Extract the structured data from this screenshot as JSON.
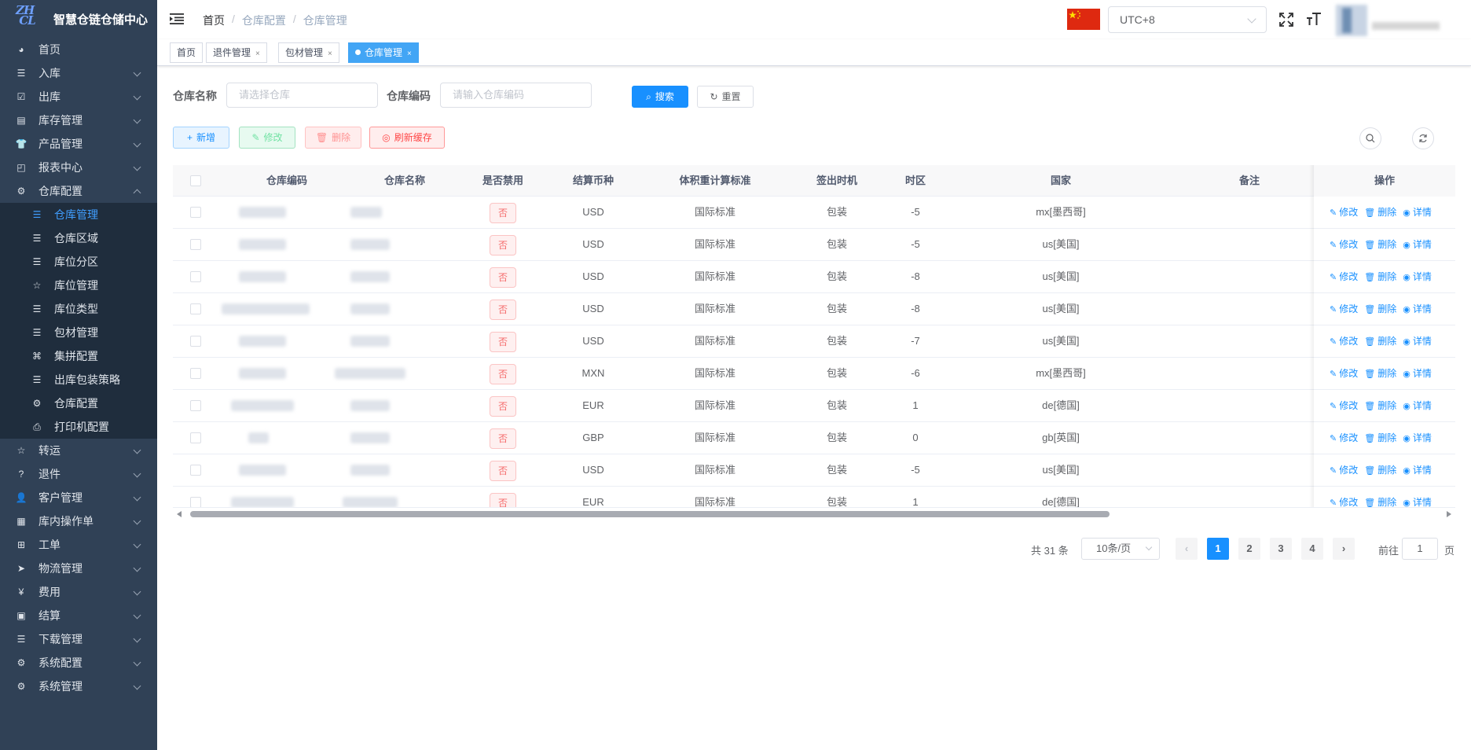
{
  "app": {
    "title": "智慧仓链仓储中心",
    "logo_text": "ZHCL"
  },
  "sidebar": {
    "items": [
      {
        "label": "首页",
        "icon": "dashboard-icon"
      },
      {
        "label": "入库",
        "icon": "list-icon"
      },
      {
        "label": "出库",
        "icon": "checkbox-icon"
      },
      {
        "label": "库存管理",
        "icon": "inventory-icon"
      },
      {
        "label": "产品管理",
        "icon": "shirt-icon"
      },
      {
        "label": "报表中心",
        "icon": "chart-icon"
      },
      {
        "label": "仓库配置",
        "icon": "gear-icon"
      },
      {
        "label": "转运",
        "icon": "star-icon"
      },
      {
        "label": "退件",
        "icon": "question-icon"
      },
      {
        "label": "客户管理",
        "icon": "user-icon"
      },
      {
        "label": "库内操作单",
        "icon": "doc-icon"
      },
      {
        "label": "工单",
        "icon": "grid-icon"
      },
      {
        "label": "物流管理",
        "icon": "send-icon"
      },
      {
        "label": "费用",
        "icon": "yen-icon"
      },
      {
        "label": "结算",
        "icon": "bill-icon"
      },
      {
        "label": "下载管理",
        "icon": "list-icon"
      },
      {
        "label": "系统配置",
        "icon": "gear-icon"
      },
      {
        "label": "系统管理",
        "icon": "gear-icon"
      }
    ],
    "submenu": [
      {
        "label": "仓库管理",
        "icon": "list-icon"
      },
      {
        "label": "仓库区域",
        "icon": "list-icon"
      },
      {
        "label": "库位分区",
        "icon": "list-icon"
      },
      {
        "label": "库位管理",
        "icon": "star-icon"
      },
      {
        "label": "库位类型",
        "icon": "list-icon"
      },
      {
        "label": "包材管理",
        "icon": "list-icon"
      },
      {
        "label": "集拼配置",
        "icon": "puzzle-icon"
      },
      {
        "label": "出库包装策略",
        "icon": "list-icon"
      },
      {
        "label": "仓库配置",
        "icon": "gear-icon"
      },
      {
        "label": "打印机配置",
        "icon": "printer-icon"
      }
    ]
  },
  "header": {
    "breadcrumb": [
      "首页",
      "仓库配置",
      "仓库管理"
    ],
    "timezone": "UTC+8"
  },
  "tags": [
    {
      "label": "首页"
    },
    {
      "label": "退件管理",
      "close": "×"
    },
    {
      "label": "包材管理",
      "close": "×"
    },
    {
      "label": "仓库管理",
      "close": "×"
    }
  ],
  "search": {
    "name_label": "仓库名称",
    "name_placeholder": "请选择仓库",
    "code_label": "仓库编码",
    "code_placeholder": "请输入仓库编码",
    "search_btn": "搜索",
    "reset_btn": "重置"
  },
  "toolbar": {
    "add": "新增",
    "edit": "修改",
    "delete": "删除",
    "refresh_cache": "刷新缓存"
  },
  "table": {
    "columns": [
      "仓库编码",
      "仓库名称",
      "是否禁用",
      "结算币种",
      "体积重计算标准",
      "签出时机",
      "时区",
      "国家",
      "备注",
      "操作"
    ],
    "rows": [
      {
        "disabled": "否",
        "currency": "USD",
        "standard": "国际标准",
        "checkout": "包装",
        "tz": "-5",
        "country": "mx[墨西哥]"
      },
      {
        "disabled": "否",
        "currency": "USD",
        "standard": "国际标准",
        "checkout": "包装",
        "tz": "-5",
        "country": "us[美国]"
      },
      {
        "disabled": "否",
        "currency": "USD",
        "standard": "国际标准",
        "checkout": "包装",
        "tz": "-8",
        "country": "us[美国]"
      },
      {
        "disabled": "否",
        "currency": "USD",
        "standard": "国际标准",
        "checkout": "包装",
        "tz": "-8",
        "country": "us[美国]"
      },
      {
        "disabled": "否",
        "currency": "USD",
        "standard": "国际标准",
        "checkout": "包装",
        "tz": "-7",
        "country": "us[美国]"
      },
      {
        "disabled": "否",
        "currency": "MXN",
        "standard": "国际标准",
        "checkout": "包装",
        "tz": "-6",
        "country": "mx[墨西哥]"
      },
      {
        "disabled": "否",
        "currency": "EUR",
        "standard": "国际标准",
        "checkout": "包装",
        "tz": "1",
        "country": "de[德国]"
      },
      {
        "disabled": "否",
        "currency": "GBP",
        "standard": "国际标准",
        "checkout": "包装",
        "tz": "0",
        "country": "gb[英国]"
      },
      {
        "disabled": "否",
        "currency": "USD",
        "standard": "国际标准",
        "checkout": "包装",
        "tz": "-5",
        "country": "us[美国]"
      },
      {
        "disabled": "否",
        "currency": "EUR",
        "standard": "国际标准",
        "checkout": "包装",
        "tz": "1",
        "country": "de[德国]"
      }
    ],
    "ops": {
      "edit": "修改",
      "delete": "删除",
      "detail": "详情"
    }
  },
  "pagination": {
    "total": "共 31 条",
    "page_size": "10条/页",
    "pages": [
      "1",
      "2",
      "3",
      "4"
    ],
    "goto_label": "前往",
    "goto_value": "1",
    "page_unit": "页"
  },
  "colors": {
    "primary": "#1890ff",
    "sidebar": "#304156",
    "submenu": "#1f2d3d",
    "danger": "#f56c6c"
  }
}
